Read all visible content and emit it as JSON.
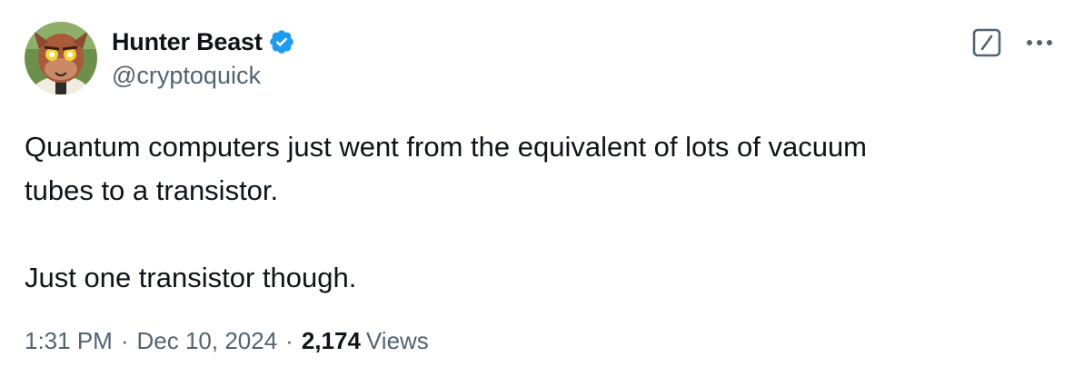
{
  "author": {
    "display_name": "Hunter Beast",
    "handle": "@cryptoquick",
    "verified": true,
    "verified_color": "#1d9bf0"
  },
  "tweet": {
    "text": "Quantum computers just went from the equivalent of lots of vacuum\ntubes to a transistor.\n\nJust one transistor though.",
    "time": "1:31 PM",
    "separator": "·",
    "date": "Dec 10, 2024",
    "views_count": "2,174",
    "views_label": "Views"
  },
  "icons": {
    "grok": "grok-icon",
    "more": "more-dots-icon",
    "verified": "verified-badge-icon",
    "avatar": "avatar"
  },
  "colors": {
    "text_primary": "#0f1419",
    "text_secondary": "#536471",
    "accent": "#1d9bf0"
  }
}
